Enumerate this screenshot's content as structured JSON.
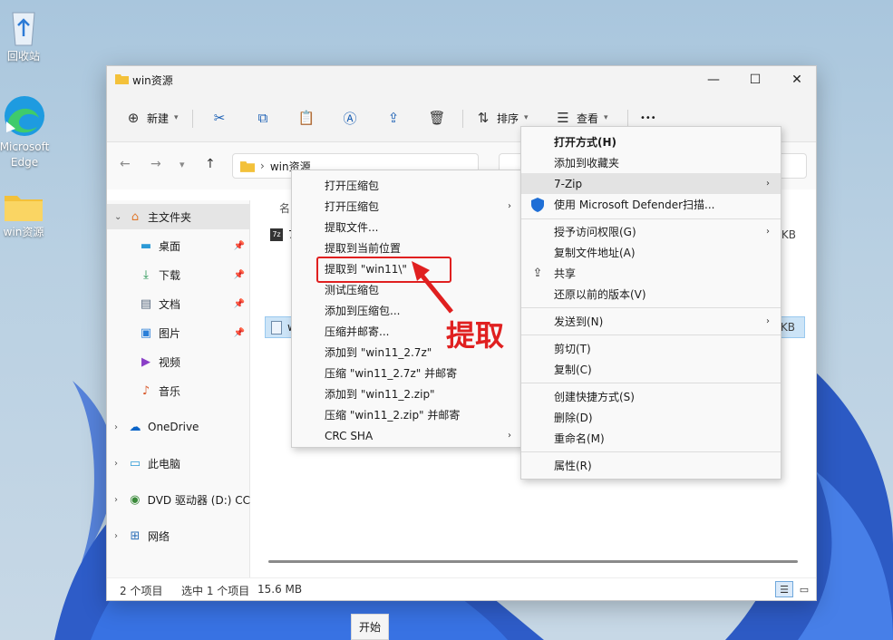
{
  "desktop": {
    "icons": [
      {
        "label": "回收站",
        "icon": "recycle-bin-icon"
      },
      {
        "label": "Microsoft Edge",
        "icon": "edge-icon"
      },
      {
        "label": "win资源",
        "icon": "folder-icon"
      }
    ]
  },
  "window": {
    "title": "win资源",
    "controls": {
      "minimize": "—",
      "maximize": "☐",
      "close": "✕"
    },
    "toolbar": {
      "new_label": "新建",
      "sort_label": "排序",
      "view_label": "查看",
      "more_label": "•••"
    },
    "address": {
      "crumb": "win资源"
    },
    "sidebar": {
      "items": [
        {
          "label": "主文件夹",
          "icon": "home-icon"
        },
        {
          "label": "桌面",
          "icon": "desktop-icon"
        },
        {
          "label": "下载",
          "icon": "download-icon"
        },
        {
          "label": "文档",
          "icon": "document-icon"
        },
        {
          "label": "图片",
          "icon": "picture-icon"
        },
        {
          "label": "视频",
          "icon": "video-icon"
        },
        {
          "label": "音乐",
          "icon": "music-icon"
        },
        {
          "label": "OneDrive",
          "icon": "cloud-icon"
        },
        {
          "label": "此电脑",
          "icon": "pc-icon"
        },
        {
          "label": "DVD 驱动器 (D:) CC",
          "icon": "dvd-icon"
        },
        {
          "label": "网络",
          "icon": "network-icon"
        }
      ]
    },
    "content": {
      "column_header": "名",
      "files": [
        {
          "name": "7",
          "size": "3 KB",
          "icon": "7zip-icon"
        },
        {
          "name": "w",
          "size": "6 KB",
          "icon": "archive-icon"
        }
      ]
    },
    "status": {
      "count": "2 个项目",
      "selection": "选中 1 个项目",
      "size": "15.6 MB"
    }
  },
  "submenu_7zip": {
    "items": [
      {
        "label": "打开压缩包",
        "submenu": false
      },
      {
        "label": "打开压缩包",
        "submenu": true
      },
      {
        "label": "提取文件...",
        "submenu": false
      },
      {
        "label": "提取到当前位置",
        "submenu": false
      },
      {
        "label": "提取到 \"win11\\\"",
        "submenu": false
      },
      {
        "label": "测试压缩包",
        "submenu": false
      },
      {
        "label": "添加到压缩包...",
        "submenu": false
      },
      {
        "label": "压缩并邮寄...",
        "submenu": false
      },
      {
        "label": "添加到 \"win11_2.7z\"",
        "submenu": false
      },
      {
        "label": "压缩 \"win11_2.7z\" 并邮寄",
        "submenu": false
      },
      {
        "label": "添加到 \"win11_2.zip\"",
        "submenu": false
      },
      {
        "label": "压缩 \"win11_2.zip\" 并邮寄",
        "submenu": false
      },
      {
        "label": "CRC SHA",
        "submenu": true
      }
    ]
  },
  "context_menu": {
    "items": [
      {
        "label": "打开方式(H)",
        "bold": true
      },
      {
        "label": "添加到收藏夹"
      },
      {
        "label": "7-Zip",
        "submenu": true
      },
      {
        "label": "使用 Microsoft Defender扫描...",
        "icon": "shield-icon"
      },
      {
        "label": "授予访问权限(G)",
        "submenu": true
      },
      {
        "label": "复制文件地址(A)"
      },
      {
        "label": "共享",
        "icon": "share-icon"
      },
      {
        "label": "还原以前的版本(V)"
      },
      {
        "label": "发送到(N)",
        "submenu": true
      },
      {
        "label": "剪切(T)"
      },
      {
        "label": "复制(C)"
      },
      {
        "label": "创建快捷方式(S)"
      },
      {
        "label": "删除(D)"
      },
      {
        "label": "重命名(M)"
      },
      {
        "label": "属性(R)"
      }
    ]
  },
  "annotation": {
    "text": "提取",
    "color": "#e02020"
  },
  "taskbar": {
    "start_tooltip": "开始"
  }
}
